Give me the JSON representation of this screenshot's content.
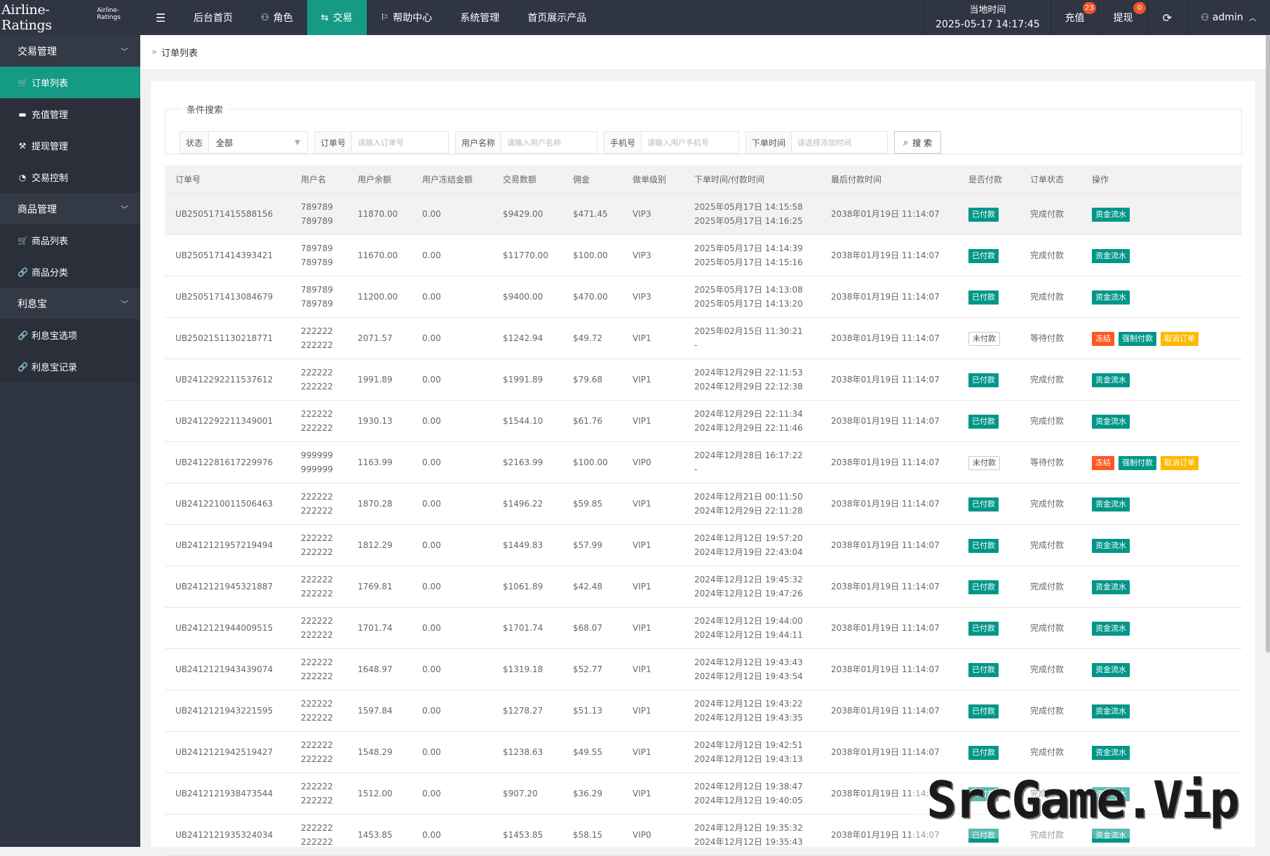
{
  "app": {
    "logo": "Airline-Ratings",
    "logo_small": "Airline-Ratings"
  },
  "topnav": [
    {
      "label": "后台首页",
      "icon": "",
      "active": false
    },
    {
      "label": "角色",
      "icon": "user-icon",
      "active": false
    },
    {
      "label": "交易",
      "icon": "exchange-icon",
      "active": true
    },
    {
      "label": "帮助中心",
      "icon": "flag-icon",
      "active": false
    },
    {
      "label": "系统管理",
      "icon": "",
      "active": false
    },
    {
      "label": "首页展示产品",
      "icon": "",
      "active": false
    }
  ],
  "header_right": {
    "time_label": "当地时间",
    "time_value": "2025-05-17 14:17:45",
    "recharge_label": "充值",
    "recharge_badge": "23",
    "withdraw_label": "提现",
    "withdraw_badge": "0",
    "user": "admin"
  },
  "sidebar": {
    "groups": [
      {
        "label": "交易管理",
        "items": [
          {
            "label": "订单列表",
            "icon": "cart-icon",
            "active": true
          },
          {
            "label": "充值管理",
            "icon": "card-icon",
            "active": false
          },
          {
            "label": "提现管理",
            "icon": "hammer-icon",
            "active": false
          },
          {
            "label": "交易控制",
            "icon": "gauge-icon",
            "active": false
          }
        ]
      },
      {
        "label": "商品管理",
        "items": [
          {
            "label": "商品列表",
            "icon": "cart-icon",
            "active": false
          },
          {
            "label": "商品分类",
            "icon": "link-icon",
            "active": false
          }
        ]
      },
      {
        "label": "利息宝",
        "items": [
          {
            "label": "利息宝选项",
            "icon": "link-icon",
            "active": false
          },
          {
            "label": "利息宝记录",
            "icon": "link-icon",
            "active": false
          }
        ]
      }
    ]
  },
  "breadcrumb": {
    "current": "订单列表"
  },
  "search": {
    "legend": "条件搜索",
    "status_label": "状态",
    "status_value": "全部",
    "order_label": "订单号",
    "order_placeholder": "请输入订单号",
    "username_label": "用户名称",
    "username_placeholder": "请输入用户名称",
    "phone_label": "手机号",
    "phone_placeholder": "请输入用户手机号",
    "time_label": "下单时间",
    "time_placeholder": "请选择添加时间",
    "button": "搜 索"
  },
  "table": {
    "columns": [
      "订单号",
      "用户名",
      "用户余额",
      "用户冻结金额",
      "交易数额",
      "佣金",
      "做单级别",
      "下单时间/付款时间",
      "最后付款时间",
      "是否付款",
      "订单状态",
      "操作"
    ],
    "rows": [
      {
        "order": "UB2505171415588156",
        "user1": "789789",
        "user2": "789789",
        "balance": "11870.00",
        "frozen": "0.00",
        "amount": "$9429.00",
        "commission": "$471.45",
        "level": "VIP3",
        "t1": "2025年05月17日 14:15:58",
        "t2": "2025年05月17日 14:16:25",
        "last": "2038年01月19日 11:14:07",
        "paid": "已付款",
        "status": "完成付款",
        "actions": [
          "资金流水"
        ]
      },
      {
        "order": "UB2505171414393421",
        "user1": "789789",
        "user2": "789789",
        "balance": "11670.00",
        "frozen": "0.00",
        "amount": "$11770.00",
        "commission": "$100.00",
        "level": "VIP3",
        "t1": "2025年05月17日 14:14:39",
        "t2": "2025年05月17日 14:15:16",
        "last": "2038年01月19日 11:14:07",
        "paid": "已付款",
        "status": "完成付款",
        "actions": [
          "资金流水"
        ]
      },
      {
        "order": "UB2505171413084679",
        "user1": "789789",
        "user2": "789789",
        "balance": "11200.00",
        "frozen": "0.00",
        "amount": "$9400.00",
        "commission": "$470.00",
        "level": "VIP3",
        "t1": "2025年05月17日 14:13:08",
        "t2": "2025年05月17日 14:13:20",
        "last": "2038年01月19日 11:14:07",
        "paid": "已付款",
        "status": "完成付款",
        "actions": [
          "资金流水"
        ]
      },
      {
        "order": "UB2502151130218771",
        "user1": "222222",
        "user2": "222222",
        "balance": "2071.57",
        "frozen": "0.00",
        "amount": "$1242.94",
        "commission": "$49.72",
        "level": "VIP1",
        "t1": "2025年02月15日 11:30:21",
        "t2": "-",
        "last": "2038年01月19日 11:14:07",
        "paid": "未付款",
        "status": "等待付款",
        "actions": [
          "冻结",
          "强制付款",
          "取消订单"
        ]
      },
      {
        "order": "UB2412292211537612",
        "user1": "222222",
        "user2": "222222",
        "balance": "1991.89",
        "frozen": "0.00",
        "amount": "$1991.89",
        "commission": "$79.68",
        "level": "VIP1",
        "t1": "2024年12月29日 22:11:53",
        "t2": "2024年12月29日 22:12:38",
        "last": "2038年01月19日 11:14:07",
        "paid": "已付款",
        "status": "完成付款",
        "actions": [
          "资金流水"
        ]
      },
      {
        "order": "UB2412292211349001",
        "user1": "222222",
        "user2": "222222",
        "balance": "1930.13",
        "frozen": "0.00",
        "amount": "$1544.10",
        "commission": "$61.76",
        "level": "VIP1",
        "t1": "2024年12月29日 22:11:34",
        "t2": "2024年12月29日 22:11:46",
        "last": "2038年01月19日 11:14:07",
        "paid": "已付款",
        "status": "完成付款",
        "actions": [
          "资金流水"
        ]
      },
      {
        "order": "UB2412281617229976",
        "user1": "999999",
        "user2": "999999",
        "balance": "1163.99",
        "frozen": "0.00",
        "amount": "$2163.99",
        "commission": "$100.00",
        "level": "VIP0",
        "t1": "2024年12月28日 16:17:22",
        "t2": "-",
        "last": "2038年01月19日 11:14:07",
        "paid": "未付款",
        "status": "等待付款",
        "actions": [
          "冻结",
          "强制付款",
          "取消订单"
        ]
      },
      {
        "order": "UB2412210011506463",
        "user1": "222222",
        "user2": "222222",
        "balance": "1870.28",
        "frozen": "0.00",
        "amount": "$1496.22",
        "commission": "$59.85",
        "level": "VIP1",
        "t1": "2024年12月21日 00:11:50",
        "t2": "2024年12月29日 22:11:28",
        "last": "2038年01月19日 11:14:07",
        "paid": "已付款",
        "status": "完成付款",
        "actions": [
          "资金流水"
        ]
      },
      {
        "order": "UB2412121957219494",
        "user1": "222222",
        "user2": "222222",
        "balance": "1812.29",
        "frozen": "0.00",
        "amount": "$1449.83",
        "commission": "$57.99",
        "level": "VIP1",
        "t1": "2024年12月12日 19:57:20",
        "t2": "2024年12月19日 22:43:04",
        "last": "2038年01月19日 11:14:07",
        "paid": "已付款",
        "status": "完成付款",
        "actions": [
          "资金流水"
        ]
      },
      {
        "order": "UB2412121945321887",
        "user1": "222222",
        "user2": "222222",
        "balance": "1769.81",
        "frozen": "0.00",
        "amount": "$1061.89",
        "commission": "$42.48",
        "level": "VIP1",
        "t1": "2024年12月12日 19:45:32",
        "t2": "2024年12月12日 19:47:26",
        "last": "2038年01月19日 11:14:07",
        "paid": "已付款",
        "status": "完成付款",
        "actions": [
          "资金流水"
        ]
      },
      {
        "order": "UB2412121944009515",
        "user1": "222222",
        "user2": "222222",
        "balance": "1701.74",
        "frozen": "0.00",
        "amount": "$1701.74",
        "commission": "$68.07",
        "level": "VIP1",
        "t1": "2024年12月12日 19:44:00",
        "t2": "2024年12月12日 19:44:11",
        "last": "2038年01月19日 11:14:07",
        "paid": "已付款",
        "status": "完成付款",
        "actions": [
          "资金流水"
        ]
      },
      {
        "order": "UB2412121943439074",
        "user1": "222222",
        "user2": "222222",
        "balance": "1648.97",
        "frozen": "0.00",
        "amount": "$1319.18",
        "commission": "$52.77",
        "level": "VIP1",
        "t1": "2024年12月12日 19:43:43",
        "t2": "2024年12月12日 19:43:54",
        "last": "2038年01月19日 11:14:07",
        "paid": "已付款",
        "status": "完成付款",
        "actions": [
          "资金流水"
        ]
      },
      {
        "order": "UB2412121943221595",
        "user1": "222222",
        "user2": "222222",
        "balance": "1597.84",
        "frozen": "0.00",
        "amount": "$1278.27",
        "commission": "$51.13",
        "level": "VIP1",
        "t1": "2024年12月12日 19:43:22",
        "t2": "2024年12月12日 19:43:35",
        "last": "2038年01月19日 11:14:07",
        "paid": "已付款",
        "status": "完成付款",
        "actions": [
          "资金流水"
        ]
      },
      {
        "order": "UB2412121942519427",
        "user1": "222222",
        "user2": "222222",
        "balance": "1548.29",
        "frozen": "0.00",
        "amount": "$1238.63",
        "commission": "$49.55",
        "level": "VIP1",
        "t1": "2024年12月12日 19:42:51",
        "t2": "2024年12月12日 19:43:13",
        "last": "2038年01月19日 11:14:07",
        "paid": "已付款",
        "status": "完成付款",
        "actions": [
          "资金流水"
        ]
      },
      {
        "order": "UB2412121938473544",
        "user1": "222222",
        "user2": "222222",
        "balance": "1512.00",
        "frozen": "0.00",
        "amount": "$907.20",
        "commission": "$36.29",
        "level": "VIP1",
        "t1": "2024年12月12日 19:38:47",
        "t2": "2024年12月12日 19:40:05",
        "last": "2038年01月19日 11:14:07",
        "paid": "已付款",
        "status": "完成付款",
        "actions": [
          "资金流水"
        ]
      },
      {
        "order": "UB2412121935324034",
        "user1": "222222",
        "user2": "222222",
        "balance": "1453.85",
        "frozen": "0.00",
        "amount": "$1453.85",
        "commission": "$58.15",
        "level": "VIP0",
        "t1": "2024年12月12日 19:35:32",
        "t2": "2024年12月12日 19:35:43",
        "last": "2038年01月19日 11:14:07",
        "paid": "已付款",
        "status": "完成付款",
        "actions": [
          "资金流水"
        ]
      }
    ]
  },
  "watermark": "SrcGame.Vip",
  "colors": {
    "topbar": "#2f3542",
    "accent": "#159b84",
    "tag_green": "#009688",
    "tag_orange": "#ff5722",
    "tag_yellow": "#ffb800",
    "badge": "#f0522b"
  }
}
